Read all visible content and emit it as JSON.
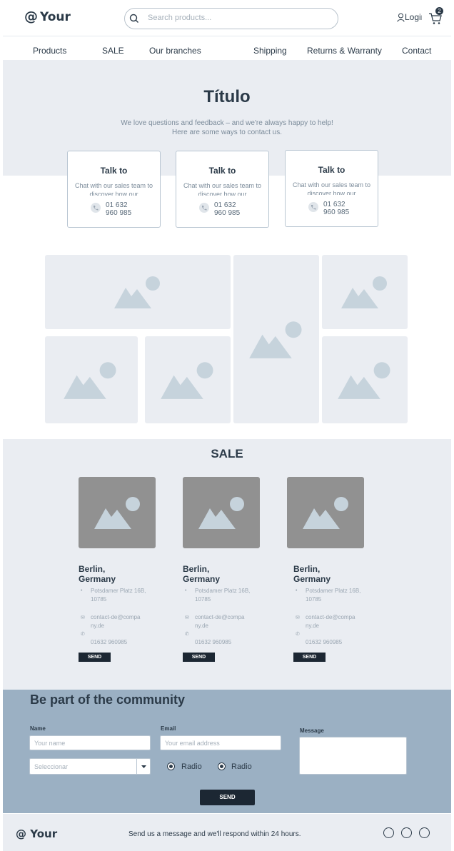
{
  "header": {
    "logo_at": "@",
    "logo_text": "Your",
    "search_placeholder": "Search products...",
    "login_label": "Login",
    "cart_count": "2"
  },
  "nav": [
    "Products",
    "SALE",
    "Our branches",
    "Shipping",
    "Returns & Warranty",
    "Contact"
  ],
  "hero": {
    "title": "Título",
    "subtitle_1": "We love questions and feedback – and we're always happy to help!",
    "subtitle_2": "Here are some ways to contact us."
  },
  "contact_cards": [
    {
      "title": "Talk to",
      "text": "Chat with our sales team to discover how our",
      "phone": "01 632 960 985"
    },
    {
      "title": "Talk to",
      "text": "Chat with our sales team to discover how our",
      "phone": "01 632 960 985"
    },
    {
      "title": "Talk to",
      "text": "Chat with our sales team to discover how our",
      "phone": "01 632 960 985"
    }
  ],
  "sale": {
    "title": "SALE",
    "items": [
      {
        "city": "Berlin, Germany",
        "address": "Potsdamer Platz 16B, 10785",
        "email": "contact-de@company.de",
        "phone": "01632 960985",
        "button": "SEND"
      },
      {
        "city": "Berlin, Germany",
        "address": "Potsdamer Platz 16B, 10785",
        "email": "contact-de@company.de",
        "phone": "01632 960985",
        "button": "SEND"
      },
      {
        "city": "Berlin, Germany",
        "address": "Potsdamer Platz 16B, 10785",
        "email": "contact-de@company.de",
        "phone": "01632 960985",
        "button": "SEND"
      }
    ]
  },
  "community": {
    "title": "Be part of the community",
    "name_label": "Name",
    "name_placeholder": "Your name",
    "email_label": "Email",
    "email_placeholder": "Your email address",
    "message_label": "Message",
    "select_value": "Seleccionar",
    "radio_1": "Radio",
    "radio_2": "Radio",
    "send": "SEND"
  },
  "footer": {
    "logo_at": "@",
    "logo_text": "Your",
    "text": "Send us a message and we'll respond within 24 hours."
  }
}
